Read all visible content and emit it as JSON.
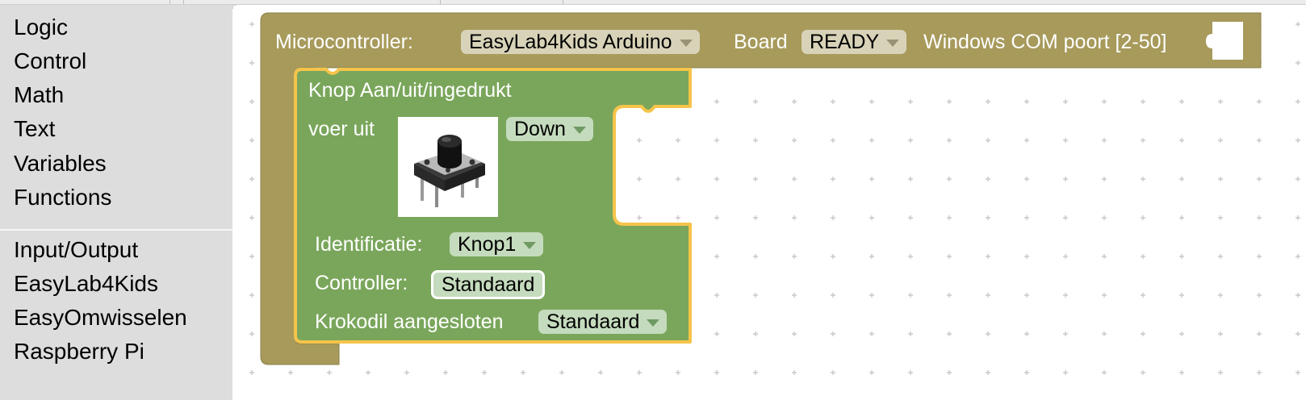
{
  "toolbox": {
    "items": [
      "Logic",
      "Control",
      "Math",
      "Text",
      "Variables",
      "Functions"
    ],
    "extra_items": [
      "Input/Output",
      "EasyLab4Kids",
      "EasyOmwisselen",
      "Raspberry Pi"
    ]
  },
  "microcontroller_block": {
    "label": "Microcontroller:",
    "board_value": "EasyLab4Kids Arduino",
    "board_label": "Board",
    "status_value": "READY",
    "port_label": "Windows COM poort [2-50]"
  },
  "button_block": {
    "title": "Knop Aan/uit/ingedrukt",
    "exec_label": "voer uit",
    "event_value": "Down",
    "image_icon": "pushbutton-photo",
    "id_label": "Identificatie:",
    "id_value": "Knop1",
    "controller_label": "Controller:",
    "controller_value": "Standaard",
    "crocodile_label": "Krokodil aangesloten",
    "crocodile_value": "Standaard"
  },
  "colors": {
    "olive_block": "#a79a5b",
    "green_block": "#7aa65b",
    "highlight": "#f5c44a",
    "toolbox_bg": "#dddddd"
  }
}
